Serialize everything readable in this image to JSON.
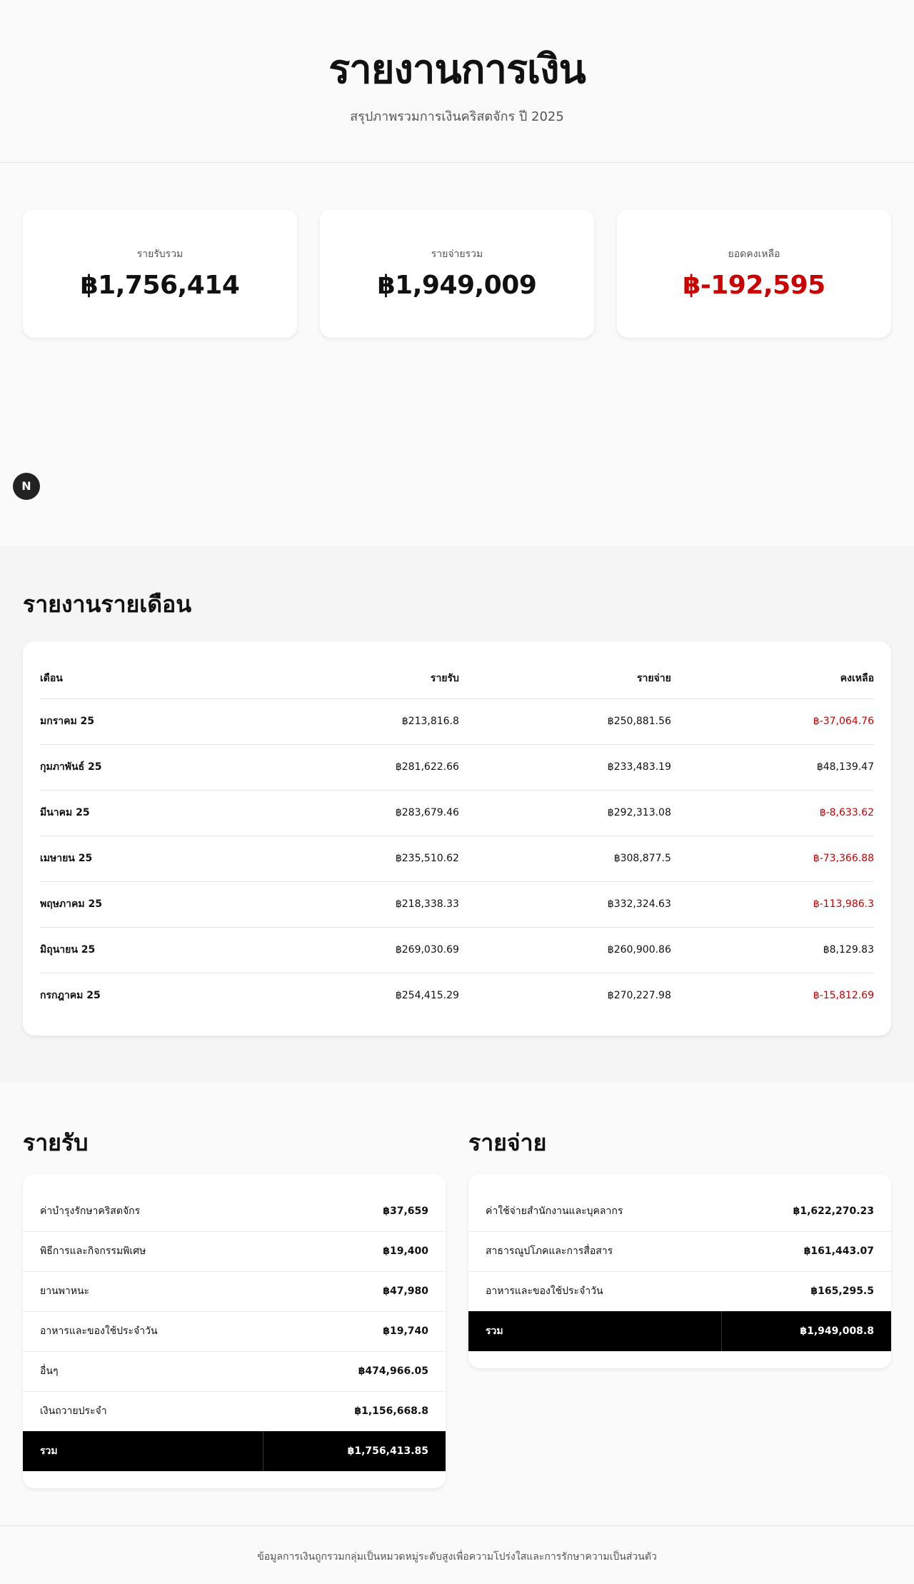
{
  "header": {
    "title": "รายงานการเงิน",
    "subtitle": "สรุปภาพรวมการเงินคริสตจักร ปี 2025"
  },
  "summary": {
    "income_label": "รายรับรวม",
    "income_value": "฿1,756,414",
    "expense_label": "รายจ่ายรวม",
    "expense_value": "฿1,949,009",
    "balance_label": "ยอดคงเหลือ",
    "balance_value": "฿-192,595"
  },
  "monthly": {
    "title": "รายงานรายเดือน",
    "columns": [
      "เดือน",
      "รายรับ",
      "รายจ่าย",
      "คงเหลือ"
    ],
    "rows": [
      {
        "month": "มกราคม 25",
        "income": "฿213,816.8",
        "expense": "฿250,881.56",
        "balance": "฿-37,064.76",
        "negative": true
      },
      {
        "month": "กุมภาพันธ์ 25",
        "income": "฿281,622.66",
        "expense": "฿233,483.19",
        "balance": "฿48,139.47",
        "negative": false
      },
      {
        "month": "มีนาคม 25",
        "income": "฿283,679.46",
        "expense": "฿292,313.08",
        "balance": "฿-8,633.62",
        "negative": true
      },
      {
        "month": "เมษายน 25",
        "income": "฿235,510.62",
        "expense": "฿308,877.5",
        "balance": "฿-73,366.88",
        "negative": true
      },
      {
        "month": "พฤษภาคม 25",
        "income": "฿218,338.33",
        "expense": "฿332,324.63",
        "balance": "฿-113,986.3",
        "negative": true
      },
      {
        "month": "มิถุนายน 25",
        "income": "฿269,030.69",
        "expense": "฿260,900.86",
        "balance": "฿8,129.83",
        "negative": false
      },
      {
        "month": "กรกฎาคม 25",
        "income": "฿254,415.29",
        "expense": "฿270,227.98",
        "balance": "฿-15,812.69",
        "negative": true
      }
    ]
  },
  "badge": {
    "letter": "N"
  },
  "income": {
    "title": "รายรับ",
    "items": [
      {
        "label": "ค่าบำรุงรักษาคริสตจักร",
        "amount": "฿37,659"
      },
      {
        "label": "พิธีการและกิจกรรมพิเศษ",
        "amount": "฿19,400"
      },
      {
        "label": "ยานพาหนะ",
        "amount": "฿47,980"
      },
      {
        "label": "อาหารและของใช้ประจำวัน",
        "amount": "฿19,740"
      },
      {
        "label": "อื่นๆ",
        "amount": "฿474,966.05"
      },
      {
        "label": "เงินถวายประจำ",
        "amount": "฿1,156,668.8"
      }
    ],
    "total_label": "รวม",
    "total_amount": "฿1,756,413.85"
  },
  "expense": {
    "title": "รายจ่าย",
    "items": [
      {
        "label": "ค่าใช้จ่ายสำนักงานและบุคลากร",
        "amount": "฿1,622,270.23"
      },
      {
        "label": "สาธารณูปโภคและการสื่อสาร",
        "amount": "฿161,443.07"
      },
      {
        "label": "อาหารและของใช้ประจำวัน",
        "amount": "฿165,295.5"
      }
    ],
    "total_label": "รวม",
    "total_amount": "฿1,949,008.8"
  },
  "footer": {
    "note": "ข้อมูลการเงินถูกรวมกลุ่มเป็นหมวดหมู่ระดับสูงเพื่อความโปร่งใสและการรักษาความเป็นส่วนตัว"
  },
  "colors": {
    "negative": "#cc0000",
    "total_bg": "#000000"
  }
}
